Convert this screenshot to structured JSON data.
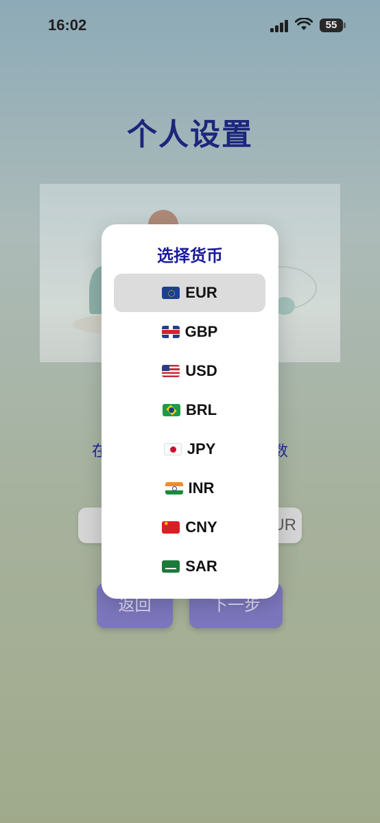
{
  "status_bar": {
    "time": "16:02",
    "battery": "55"
  },
  "page": {
    "title": "个人设置",
    "hint_visible": "在此输入金额，最多两位小数",
    "amount_currency": "UR",
    "back_label": "返回",
    "next_label": "下一步"
  },
  "picker": {
    "title": "选择货币",
    "selected": "EUR",
    "options": [
      {
        "code": "EUR",
        "flag": "eu-flag-icon"
      },
      {
        "code": "GBP",
        "flag": "gb-flag-icon"
      },
      {
        "code": "USD",
        "flag": "us-flag-icon"
      },
      {
        "code": "BRL",
        "flag": "br-flag-icon"
      },
      {
        "code": "JPY",
        "flag": "jp-flag-icon"
      },
      {
        "code": "INR",
        "flag": "in-flag-icon"
      },
      {
        "code": "CNY",
        "flag": "cn-flag-icon"
      },
      {
        "code": "SAR",
        "flag": "sa-flag-icon"
      }
    ]
  }
}
